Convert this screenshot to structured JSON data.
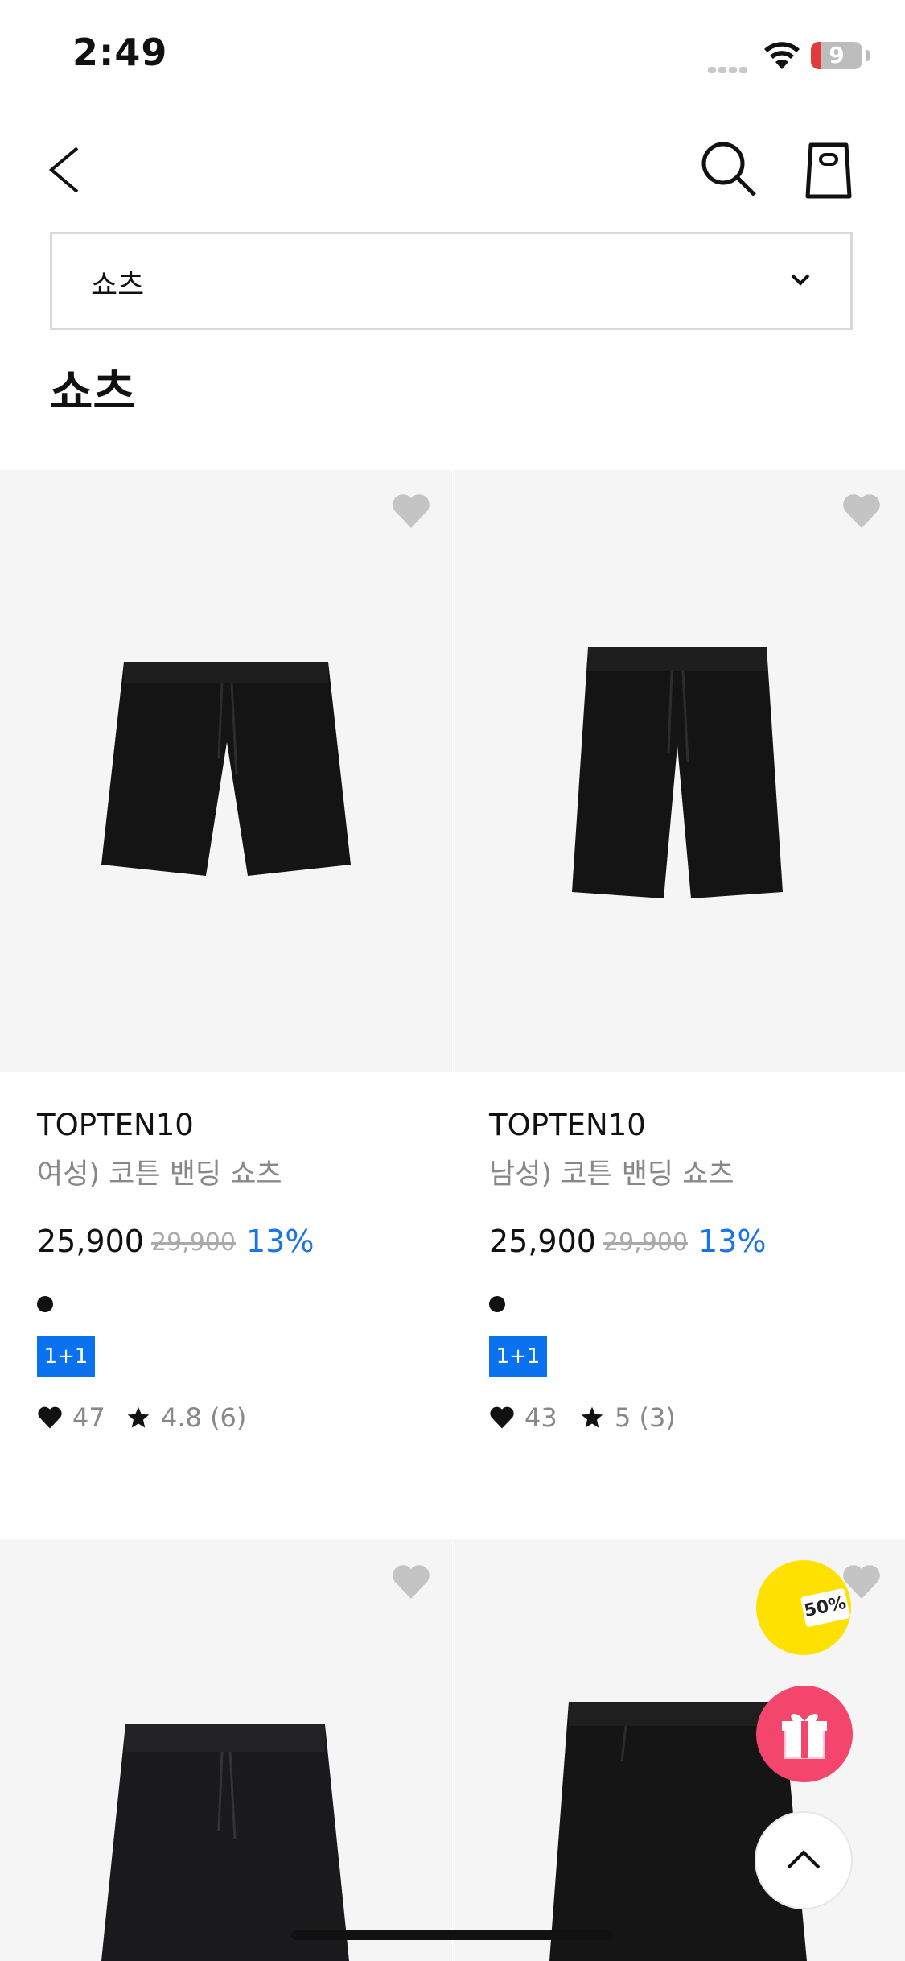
{
  "status_bar": {
    "time": "2:49",
    "battery": "9"
  },
  "category_select": {
    "selected": "쇼츠"
  },
  "page_title": "쇼츠",
  "products": [
    {
      "brand": "TOPTEN10",
      "name": "여성) 코튼 밴딩 쇼츠",
      "price": "25,900",
      "original_price": "29,900",
      "discount": "13%",
      "badge": "1+1",
      "likes": "47",
      "rating": "4.8 (6)"
    },
    {
      "brand": "TOPTEN10",
      "name": "남성) 코튼 밴딩 쇼츠",
      "price": "25,900",
      "original_price": "29,900",
      "discount": "13%",
      "badge": "1+1",
      "likes": "43",
      "rating": "5 (3)"
    }
  ],
  "floating": {
    "coupon_label": "50%"
  },
  "colors": {
    "accent_blue": "#1a73e8",
    "badge_blue": "#0a72ef",
    "gift_pink": "#f4456c",
    "coupon_yellow": "#ffe100"
  },
  "icons": [
    "back-arrow-icon",
    "search-icon",
    "shopping-bag-icon",
    "chevron-down-icon",
    "heart-icon",
    "star-icon",
    "gift-icon",
    "arrow-up-icon"
  ]
}
